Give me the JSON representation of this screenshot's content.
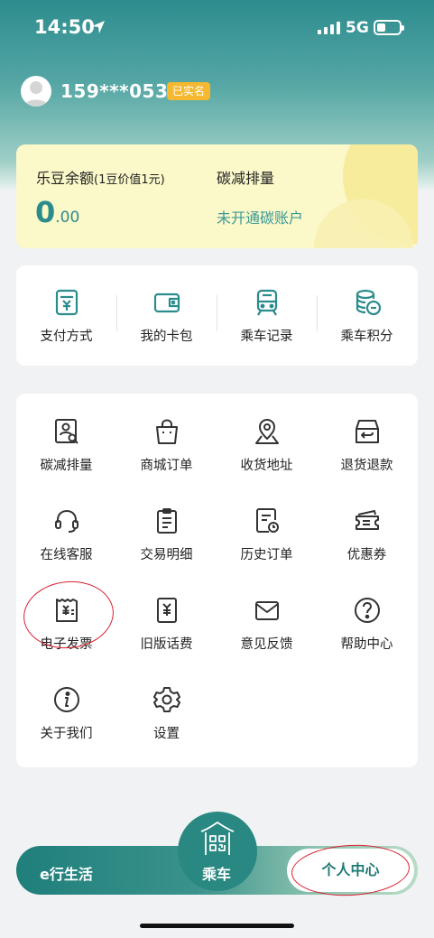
{
  "status_bar": {
    "time": "14:50",
    "network": "5G"
  },
  "user": {
    "phone": "159***0533",
    "verified_badge": "已实名"
  },
  "balance_card": {
    "label": "乐豆余额",
    "label_note": "(1豆价值1元)",
    "value_int": "0",
    "value_dec": ".00",
    "carbon_label": "碳减排量",
    "carbon_status": "未开通碳账户"
  },
  "quick_actions": [
    {
      "label": "支付方式",
      "icon": "payment-icon"
    },
    {
      "label": "我的卡包",
      "icon": "wallet-icon"
    },
    {
      "label": "乘车记录",
      "icon": "train-icon"
    },
    {
      "label": "乘车积分",
      "icon": "coins-icon"
    }
  ],
  "services": [
    {
      "label": "碳减排量",
      "icon": "carbon-report-icon"
    },
    {
      "label": "商城订单",
      "icon": "shopping-bag-icon"
    },
    {
      "label": "收货地址",
      "icon": "location-icon"
    },
    {
      "label": "退货退款",
      "icon": "refund-box-icon"
    },
    {
      "label": "在线客服",
      "icon": "headset-icon"
    },
    {
      "label": "交易明细",
      "icon": "clipboard-icon"
    },
    {
      "label": "历史订单",
      "icon": "history-order-icon"
    },
    {
      "label": "优惠券",
      "icon": "coupon-icon"
    },
    {
      "label": "电子发票",
      "icon": "invoice-icon"
    },
    {
      "label": "旧版话费",
      "icon": "phone-bill-icon"
    },
    {
      "label": "意见反馈",
      "icon": "mail-icon"
    },
    {
      "label": "帮助中心",
      "icon": "help-icon"
    },
    {
      "label": "关于我们",
      "icon": "info-icon"
    },
    {
      "label": "设置",
      "icon": "settings-icon"
    }
  ],
  "bottom_nav": {
    "life": "e行生活",
    "ride": "乘车",
    "me": "个人中心"
  },
  "colors": {
    "teal": "#2b8c8c",
    "badge": "#f5b82e",
    "annotation_red": "#d8202f",
    "card_yellow": "#fbf8c9"
  }
}
